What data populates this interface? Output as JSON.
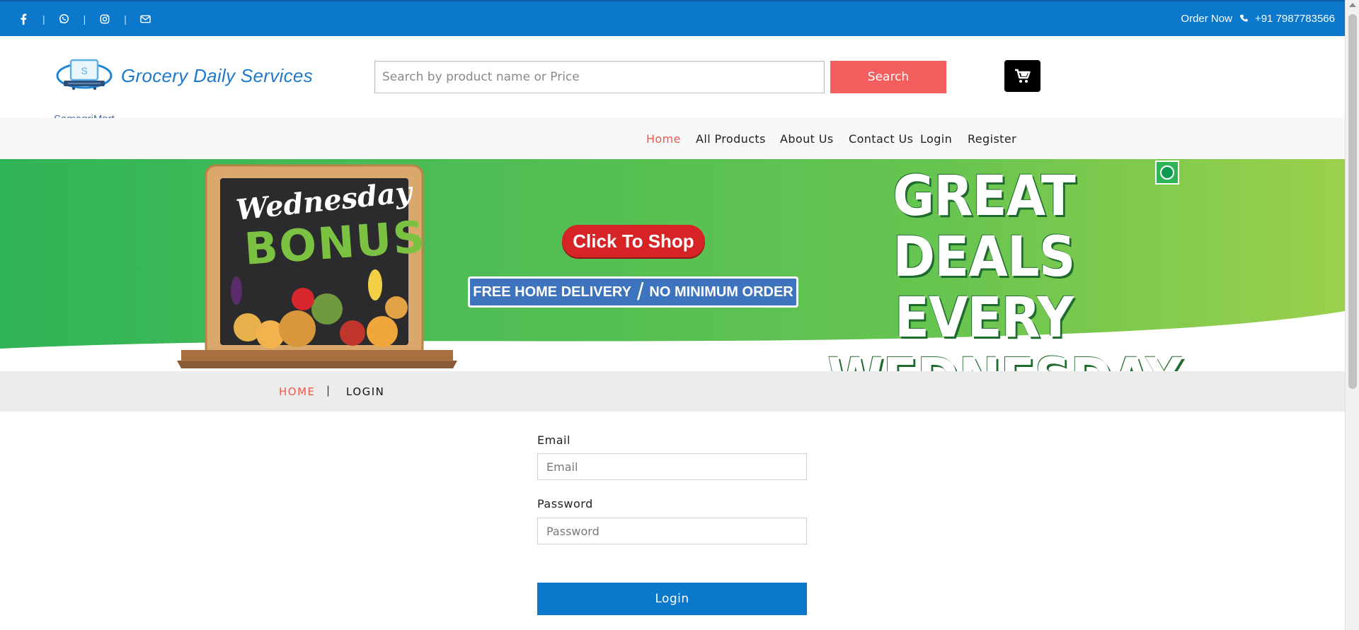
{
  "topbar": {
    "social_icons": [
      "facebook-icon",
      "whatsapp-icon",
      "instagram-icon",
      "mail-icon"
    ],
    "separator": "|",
    "order_label": "Order Now",
    "phone": "+91 7987783566"
  },
  "header": {
    "brand": "SamagriMart",
    "title": "Grocery Daily Services",
    "search_placeholder": "Search by product name or Price",
    "search_label": "Search",
    "cart_icon": "cart-icon"
  },
  "nav": {
    "items": [
      {
        "label": "Home",
        "active": true
      },
      {
        "label": "All Products"
      },
      {
        "label": "About Us"
      },
      {
        "label": "Contact Us"
      },
      {
        "label": "Login"
      },
      {
        "label": "Register"
      }
    ]
  },
  "banner": {
    "board_line1": "Wednesday",
    "board_line2": "BONUS",
    "shop_button": "Click To Shop",
    "delivery_left": "FREE HOME DELIVERY",
    "delivery_slash": "/",
    "delivery_right": "NO MINIMUM ORDER",
    "headline1": "GREAT DEALS",
    "headline2": "EVERY",
    "headline3": "WEDNESDAY",
    "colors": {
      "green_start": "#2fb457",
      "green_end": "#9bd04c",
      "button_red": "#d62326",
      "ribbon_blue": "#3e74bd"
    }
  },
  "breadcrumb": {
    "home": "HOME",
    "separator": "|",
    "current": "LOGIN"
  },
  "form": {
    "email_label": "Email",
    "email_placeholder": "Email",
    "password_label": "Password",
    "password_placeholder": "Password",
    "submit_label": "Login"
  },
  "colors": {
    "topbar": "#0b78cb",
    "accent_red": "#f35e5e",
    "nav_active": "#ef5a4f",
    "primary_button": "#0b78cb"
  }
}
